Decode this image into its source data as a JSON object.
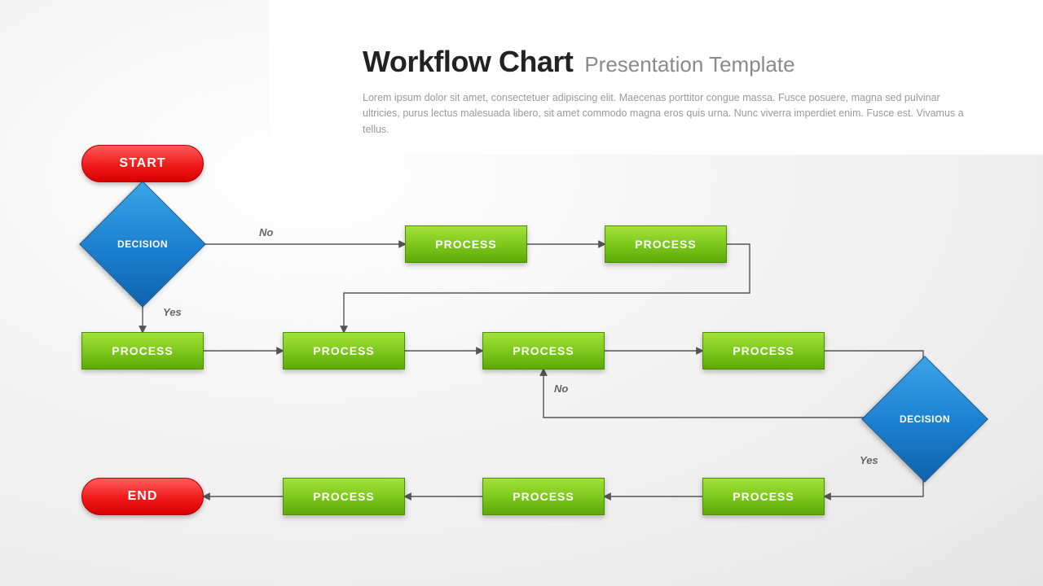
{
  "header": {
    "title_main": "Workflow Chart",
    "title_sub": "Presentation Template",
    "description": "Lorem ipsum dolor sit amet, consectetuer adipiscing elit. Maecenas porttitor congue massa. Fusce posuere, magna sed pulvinar ultricies, purus lectus malesuada libero, sit amet commodo magna eros quis urna. Nunc viverra imperdiet enim. Fusce est. Vivamus a tellus."
  },
  "colors": {
    "terminator": "#ef1a1a",
    "process": "#7bc61a",
    "decision": "#1b7fcf",
    "connector": "#555555"
  },
  "nodes": {
    "start": {
      "type": "terminator",
      "label": "START"
    },
    "end": {
      "type": "terminator",
      "label": "END"
    },
    "decision1": {
      "type": "decision",
      "label": "DECISION"
    },
    "decision2": {
      "type": "decision",
      "label": "DECISION"
    },
    "p_no_1": {
      "type": "process",
      "label": "PROCESS"
    },
    "p_no_2": {
      "type": "process",
      "label": "PROCESS"
    },
    "p_yes_1": {
      "type": "process",
      "label": "PROCESS"
    },
    "p_yes_2": {
      "type": "process",
      "label": "PROCESS"
    },
    "p_yes_3": {
      "type": "process",
      "label": "PROCESS"
    },
    "p_yes_4": {
      "type": "process",
      "label": "PROCESS"
    },
    "p_bot_1": {
      "type": "process",
      "label": "PROCESS"
    },
    "p_bot_2": {
      "type": "process",
      "label": "PROCESS"
    },
    "p_bot_3": {
      "type": "process",
      "label": "PROCESS"
    }
  },
  "edge_labels": {
    "d1_no": "No",
    "d1_yes": "Yes",
    "d2_no": "No",
    "d2_yes": "Yes"
  },
  "flow": [
    "start -> decision1",
    "decision1 -No-> p_no_1 -> p_no_2 -> p_yes_2",
    "decision1 -Yes-> p_yes_1 -> p_yes_2 -> p_yes_3 -> p_yes_4 -> decision2",
    "decision2 -No-> p_yes_3",
    "decision2 -Yes-> p_bot_1 -> p_bot_2 -> p_bot_3 -> end"
  ]
}
